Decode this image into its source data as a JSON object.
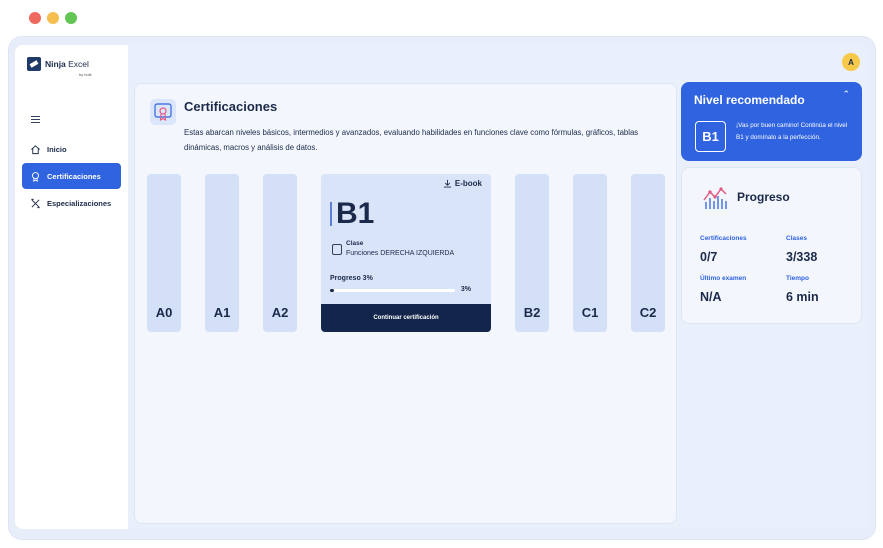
{
  "window": {
    "dot_colors": [
      "#ee6a5f",
      "#f5be4f",
      "#62c554"
    ]
  },
  "brand": {
    "name": "Ninja",
    "name_light": " Excel",
    "sub": "by bulk"
  },
  "sidebar": {
    "items": [
      {
        "label": "Inicio",
        "icon": "home-icon",
        "active": false
      },
      {
        "label": "Certificaciones",
        "icon": "certificate-icon",
        "active": true
      },
      {
        "label": "Especializaciones",
        "icon": "tools-icon",
        "active": false
      }
    ]
  },
  "user": {
    "avatar_initial": "A"
  },
  "certifications": {
    "title": "Certificaciones",
    "description": "Estas abarcan niveles básicos, intermedios y avanzados, evaluando habilidades en funciones clave como fórmulas, gráficos, tablas dinámicas, macros y análisis de datos.",
    "levels": [
      "A0",
      "A1",
      "A2",
      "B2",
      "C1",
      "C2"
    ],
    "current": {
      "level": "B1",
      "ebook_label": "E-book",
      "class_label": "Clase",
      "class_value": "Funciones DERECHA IZQUIERDA",
      "progress_label": "Progreso 3%",
      "progress_value": "3%",
      "progress_fraction": 0.03,
      "button_label": "Continuar certificación"
    }
  },
  "recommended": {
    "title": "Nivel recomendado",
    "level": "B1",
    "text": "¡Vas por buen camino! Continúa el nivel B1 y domínalo a la perfección."
  },
  "progress": {
    "title": "Progreso",
    "stats": [
      {
        "label": "Certificaciones",
        "value": "0/7"
      },
      {
        "label": "Clases",
        "value": "3/338"
      },
      {
        "label": "Último examen",
        "value": "N/A"
      },
      {
        "label": "Tiempo",
        "value": "6 min"
      }
    ]
  },
  "colors": {
    "accent": "#2f63e0",
    "dark": "#13254a",
    "avatar": "#f7c948"
  }
}
